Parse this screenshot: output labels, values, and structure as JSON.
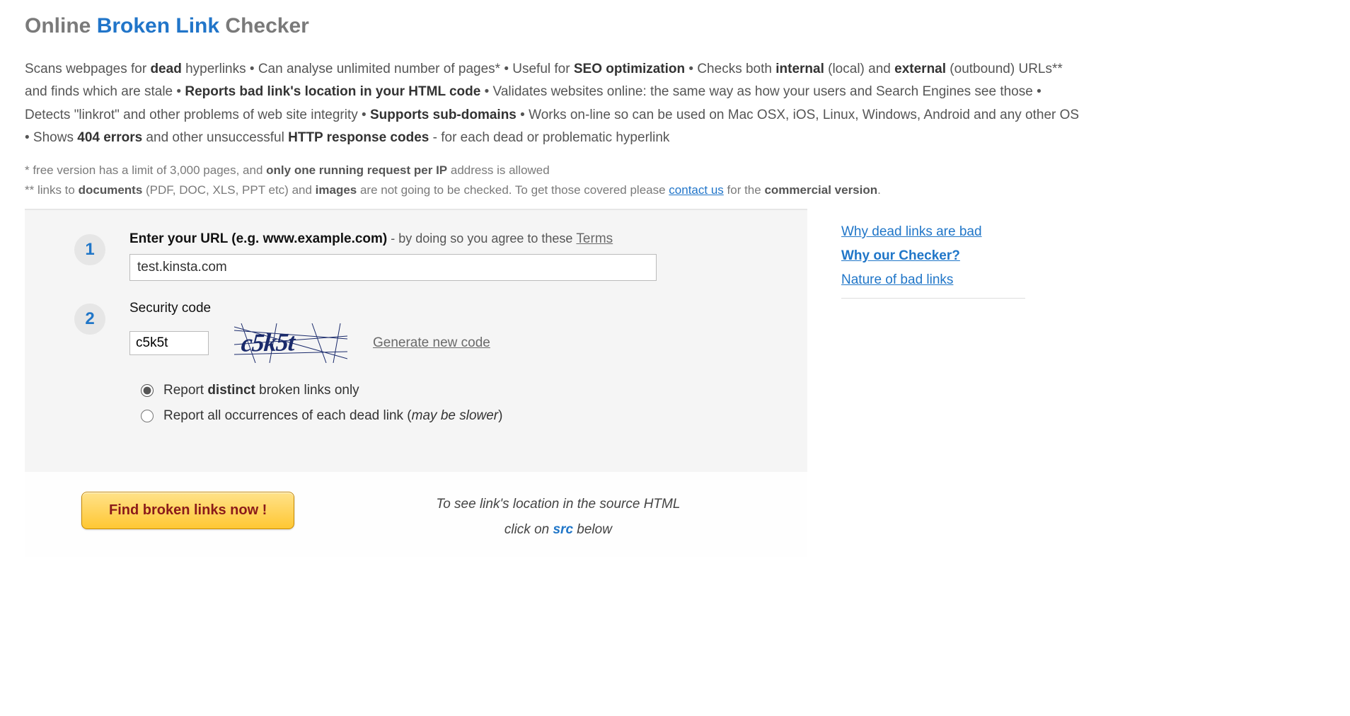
{
  "title": {
    "part1": "Online ",
    "part2": "Broken Link",
    "part3": " Checker"
  },
  "intro_parts": [
    {
      "t": "Scans webpages for "
    },
    {
      "t": "dead",
      "b": true
    },
    {
      "t": " hyperlinks • Can analyse unlimited number of pages* • Useful for "
    },
    {
      "t": "SEO optimization",
      "b": true
    },
    {
      "t": " • Checks both "
    },
    {
      "t": "internal",
      "b": true
    },
    {
      "t": " (local) and "
    },
    {
      "t": "external",
      "b": true
    },
    {
      "t": " (outbound) URLs** and finds which are stale • "
    },
    {
      "t": "Reports bad link's location in your HTML code",
      "b": true
    },
    {
      "t": " • Validates websites online: the same way as how your users and Search Engines see those • Detects \"linkrot\" and other problems of web site integrity • "
    },
    {
      "t": "Supports sub-domains",
      "b": true
    },
    {
      "t": " • Works on-line so can be used on Mac OSX, iOS, Linux, Windows, Android and any other OS • Shows "
    },
    {
      "t": "404 errors",
      "b": true
    },
    {
      "t": " and other unsuccessful "
    },
    {
      "t": "HTTP response codes",
      "b": true
    },
    {
      "t": " - for each dead or problematic hyperlink"
    }
  ],
  "footnote1_parts": [
    {
      "t": "*  free version has a limit of 3,000 pages, and "
    },
    {
      "t": "only one running request per IP",
      "b": true
    },
    {
      "t": " address is allowed"
    }
  ],
  "footnote2_parts": [
    {
      "t": "** links to "
    },
    {
      "t": "documents",
      "b": true
    },
    {
      "t": " (PDF, DOC, XLS, PPT etc) and "
    },
    {
      "t": "images",
      "b": true
    },
    {
      "t": " are not going to be checked. To get those covered please "
    }
  ],
  "footnote2_link": "contact us",
  "footnote2_tail_parts": [
    {
      "t": " for the "
    },
    {
      "t": "commercial version",
      "b": true
    },
    {
      "t": "."
    }
  ],
  "step1": {
    "num": "1",
    "label_bold": "Enter your URL (e.g. www.example.com)",
    "label_tail": " - by doing so you agree to these ",
    "terms": "Terms",
    "value": "test.kinsta.com"
  },
  "step2": {
    "num": "2",
    "label": "Security code",
    "value": "c5k5t",
    "captcha_text": "c5k5t",
    "generate": "Generate new code"
  },
  "radios": {
    "opt1_pre": "Report ",
    "opt1_bold": "distinct",
    "opt1_post": " broken links only",
    "opt2_pre": "Report all occurrences of each dead link (",
    "opt2_ital": "may be slower",
    "opt2_post": ")"
  },
  "submit_label": "Find broken links now !",
  "hint_line1": "To see link's location in the source HTML",
  "hint_line2_pre": "click on ",
  "hint_line2_src": "src",
  "hint_line2_post": " below",
  "sidebar": {
    "links": [
      {
        "label": "Why dead links are bad",
        "active": false
      },
      {
        "label": "Why our Checker?",
        "active": true
      },
      {
        "label": "Nature of bad links",
        "active": false
      }
    ]
  }
}
